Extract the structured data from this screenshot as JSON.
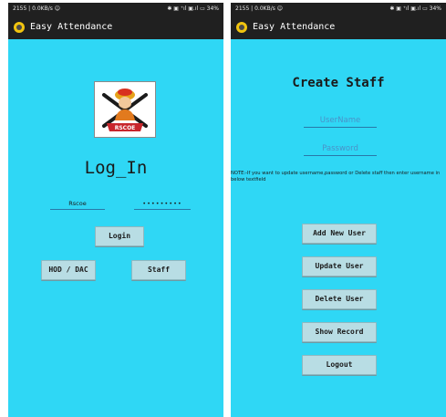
{
  "login_screen": {
    "status_left": "2155 | 0.0KB/s ☺",
    "status_right": "✱ ▣ ⁺ıl ▣.ıl ▭ 34%",
    "app_title": "Easy Attendance",
    "logo_text": "RSCOE",
    "heading": "Log_In",
    "username_value": "Rscoe",
    "password_value": "•••••••••",
    "login_label": "Login",
    "hod_label": "HOD / DAC",
    "staff_label": "Staff"
  },
  "staff_screen": {
    "status_left": "2155 | 0.0KB/s ☺",
    "status_right": "✱ ▣ ⁺ıl ▣.ıl ▭ 34%",
    "app_title": "Easy Attendance",
    "heading": "Create Staff",
    "username_placeholder": "UserName",
    "password_placeholder": "Password",
    "note": "NOTE:-If you want to update username,password or Delete staff then enter username in below textfield",
    "buttons": [
      "Add New User",
      "Update User",
      "Delete User",
      "Show Record",
      "Logout"
    ]
  },
  "colors": {
    "screen_bg": "#2fd7f5",
    "appbar_bg": "#202020",
    "button_bg": "#b8dde4",
    "field_underline": "#2878a8"
  }
}
